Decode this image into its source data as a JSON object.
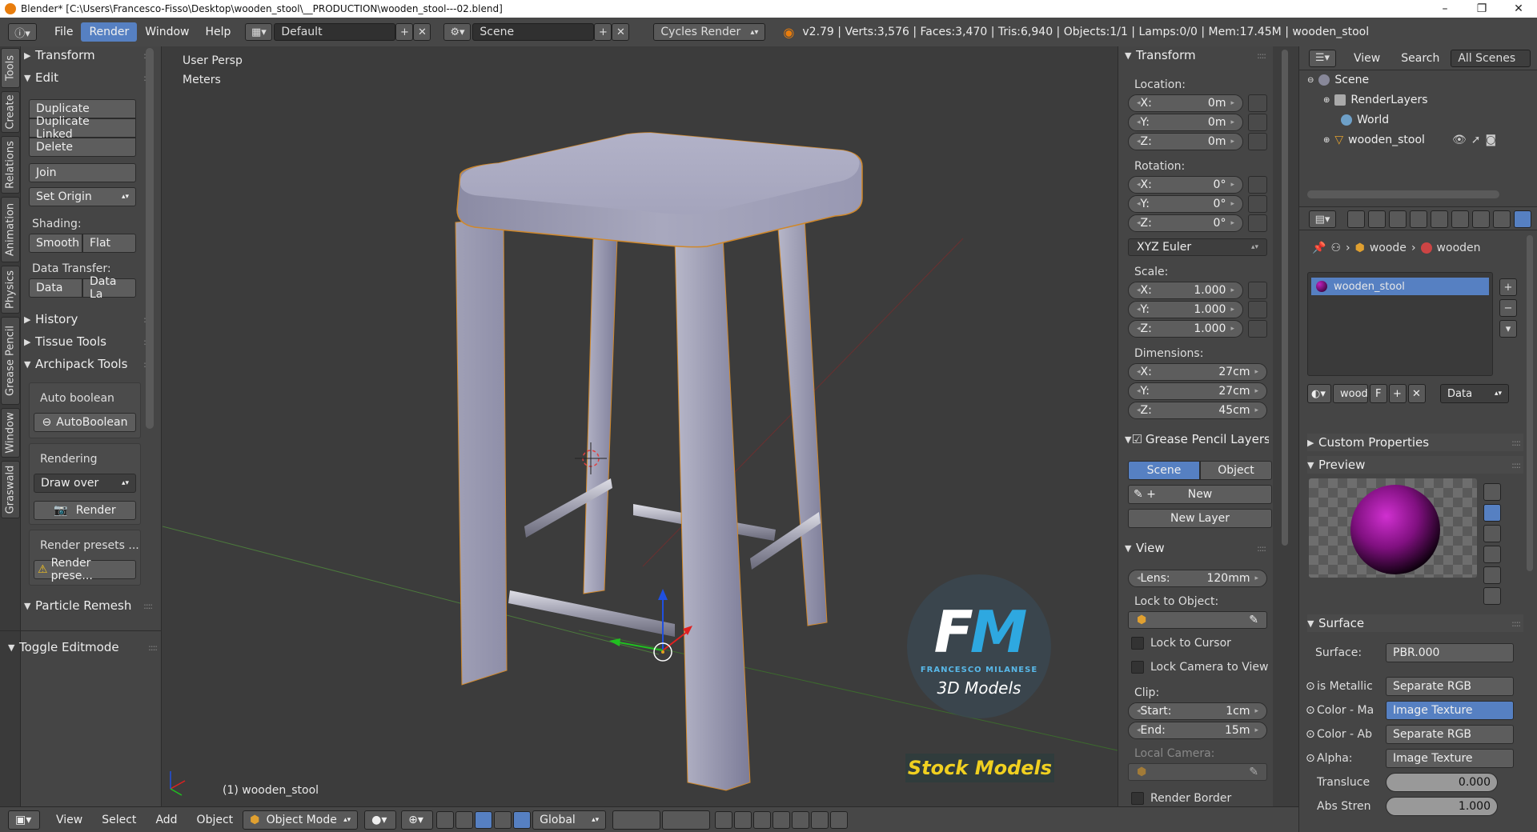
{
  "titlebar": {
    "title": "Blender* [C:\\Users\\Francesco-Fisso\\Desktop\\wooden_stool\\__PRODUCTION\\wooden_stool---02.blend]",
    "minimize": "–",
    "maximize": "❐",
    "close": "✕"
  },
  "header": {
    "menus": [
      "File",
      "Render",
      "Window",
      "Help"
    ],
    "active_menu": "Render",
    "layout": "Default",
    "scene": "Scene",
    "engine": "Cycles Render",
    "stats": "v2.79 | Verts:3,576 | Faces:3,470 | Tris:6,940 | Objects:1/1 | Lamps:0/0 | Mem:17.45M | wooden_stool"
  },
  "left_tabs": [
    "Tools",
    "Create",
    "Relations",
    "Animation",
    "Physics",
    "Grease Pencil",
    "Window",
    "Graswald"
  ],
  "tools": {
    "transform": "Transform",
    "edit": "Edit",
    "duplicate": "Duplicate",
    "duplicate_linked": "Duplicate Linked",
    "delete": "Delete",
    "join": "Join",
    "set_origin": "Set Origin",
    "shading_label": "Shading:",
    "smooth": "Smooth",
    "flat": "Flat",
    "data_transfer_label": "Data Transfer:",
    "data": "Data",
    "data_la": "Data La",
    "history": "History",
    "tissue_tools": "Tissue Tools",
    "archipack_tools": "Archipack Tools",
    "auto_boolean_label": "Auto boolean",
    "auto_boolean_btn": "AutoBoolean",
    "rendering_label": "Rendering",
    "draw_over": "Draw over",
    "render_btn": "Render",
    "render_presets_label": "Render presets ...",
    "render_presets_btn": "Render prese...",
    "particle_remesh": "Particle Remesh",
    "toggle_editmode": "Toggle Editmode"
  },
  "viewport": {
    "view_name": "User Persp",
    "units": "Meters",
    "object_label": "(1) wooden_stool",
    "watermark_title": "FM",
    "watermark_sub": "FRANCESCO MILANESE",
    "watermark_models": "3D Models",
    "watermark_stock": "Stock Models"
  },
  "npanel": {
    "transform": "Transform",
    "location_label": "Location:",
    "location": [
      {
        "axis": "X:",
        "value": "0m"
      },
      {
        "axis": "Y:",
        "value": "0m"
      },
      {
        "axis": "Z:",
        "value": "0m"
      }
    ],
    "rotation_label": "Rotation:",
    "rotation": [
      {
        "axis": "X:",
        "value": "0°"
      },
      {
        "axis": "Y:",
        "value": "0°"
      },
      {
        "axis": "Z:",
        "value": "0°"
      }
    ],
    "rotation_mode": "XYZ Euler",
    "scale_label": "Scale:",
    "scale": [
      {
        "axis": "X:",
        "value": "1.000"
      },
      {
        "axis": "Y:",
        "value": "1.000"
      },
      {
        "axis": "Z:",
        "value": "1.000"
      }
    ],
    "dimensions_label": "Dimensions:",
    "dimensions": [
      {
        "axis": "X:",
        "value": "27cm"
      },
      {
        "axis": "Y:",
        "value": "27cm"
      },
      {
        "axis": "Z:",
        "value": "45cm"
      }
    ],
    "grease_pencil_layers": "Grease Pencil Layers",
    "gp_scene": "Scene",
    "gp_object": "Object",
    "gp_new": "New",
    "gp_new_layer": "New Layer",
    "view": "View",
    "lens_label": "Lens:",
    "lens_value": "120mm",
    "lock_to_object": "Lock to Object:",
    "lock_to_cursor": "Lock to Cursor",
    "lock_camera": "Lock Camera to View",
    "clip_label": "Clip:",
    "clip_start_label": "Start:",
    "clip_start": "1cm",
    "clip_end_label": "End:",
    "clip_end": "15m",
    "local_camera": "Local Camera:",
    "render_border": "Render Border"
  },
  "outliner": {
    "view": "View",
    "search": "Search",
    "all_scenes": "All Scenes",
    "items": [
      {
        "label": "Scene"
      },
      {
        "label": "RenderLayers"
      },
      {
        "label": "World"
      },
      {
        "label": "wooden_stool"
      }
    ]
  },
  "properties": {
    "breadcrumb_1": "woode",
    "breadcrumb_2": "wooden",
    "material_slot": "wooden_stool",
    "mat_name": "wood",
    "mat_f": "F",
    "mat_data": "Data",
    "custom_properties": "Custom Properties",
    "preview": "Preview",
    "surface": "Surface",
    "rows": [
      {
        "label": "Surface:",
        "value": "PBR.000"
      },
      {
        "label": "is Metallic",
        "value": "Separate RGB"
      },
      {
        "label": "Color - Ma",
        "value": "Image Texture"
      },
      {
        "label": "Color - Ab",
        "value": "Separate RGB"
      },
      {
        "label": "Alpha:",
        "value": "Image Texture"
      },
      {
        "label": "Transluce",
        "value": "0.000"
      },
      {
        "label": "Abs Stren",
        "value": "1.000"
      }
    ]
  },
  "bottombar": {
    "view": "View",
    "select": "Select",
    "add": "Add",
    "object": "Object",
    "mode": "Object Mode",
    "orientation": "Global"
  }
}
